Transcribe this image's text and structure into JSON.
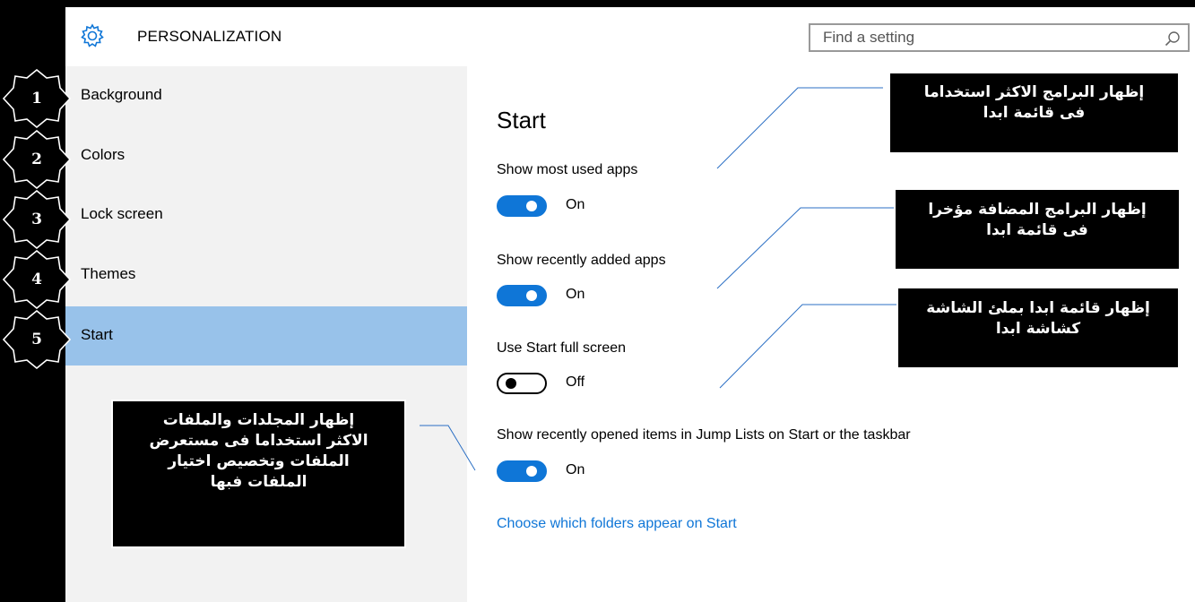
{
  "header": {
    "title": "PERSONALIZATION",
    "search_placeholder": "Find a setting",
    "gear_icon": "gear-icon",
    "search_icon": "search-icon"
  },
  "sidebar": {
    "items": [
      {
        "label": "Background",
        "active": false
      },
      {
        "label": "Colors",
        "active": false
      },
      {
        "label": "Lock screen",
        "active": false
      },
      {
        "label": "Themes",
        "active": false
      },
      {
        "label": "Start",
        "active": true
      }
    ]
  },
  "main": {
    "title": "Start",
    "settings": [
      {
        "label": "Show most used apps",
        "state": "On"
      },
      {
        "label": "Show recently added apps",
        "state": "On"
      },
      {
        "label": "Use Start full screen",
        "state": "Off"
      },
      {
        "label": "Show recently opened items in Jump Lists on Start or the taskbar",
        "state": "On"
      }
    ],
    "link": "Choose which folders appear on Start"
  },
  "badges": [
    "1",
    "2",
    "3",
    "4",
    "5"
  ],
  "callouts": {
    "most_used": [
      "إظهار البرامج الاكثر استخداما",
      "فى قائمة ابدا"
    ],
    "recently_added": [
      "إظهار البرامج المضافة مؤخرا",
      "فى قائمة ابدا"
    ],
    "full_screen": [
      "إظهار قائمة ابدا بملئ الشاشة",
      "كشاشة ابدا"
    ],
    "jump_lists": [
      "إظهار المجلدات والملفات",
      "الاكثر استخداما فى مستعرض",
      "الملفات وتخصيص اختيار",
      "الملفات فبها"
    ]
  },
  "colors": {
    "accent": "#0f76d7",
    "active_nav": "#98c2ea",
    "sidebar_bg": "#f2f2f2"
  }
}
